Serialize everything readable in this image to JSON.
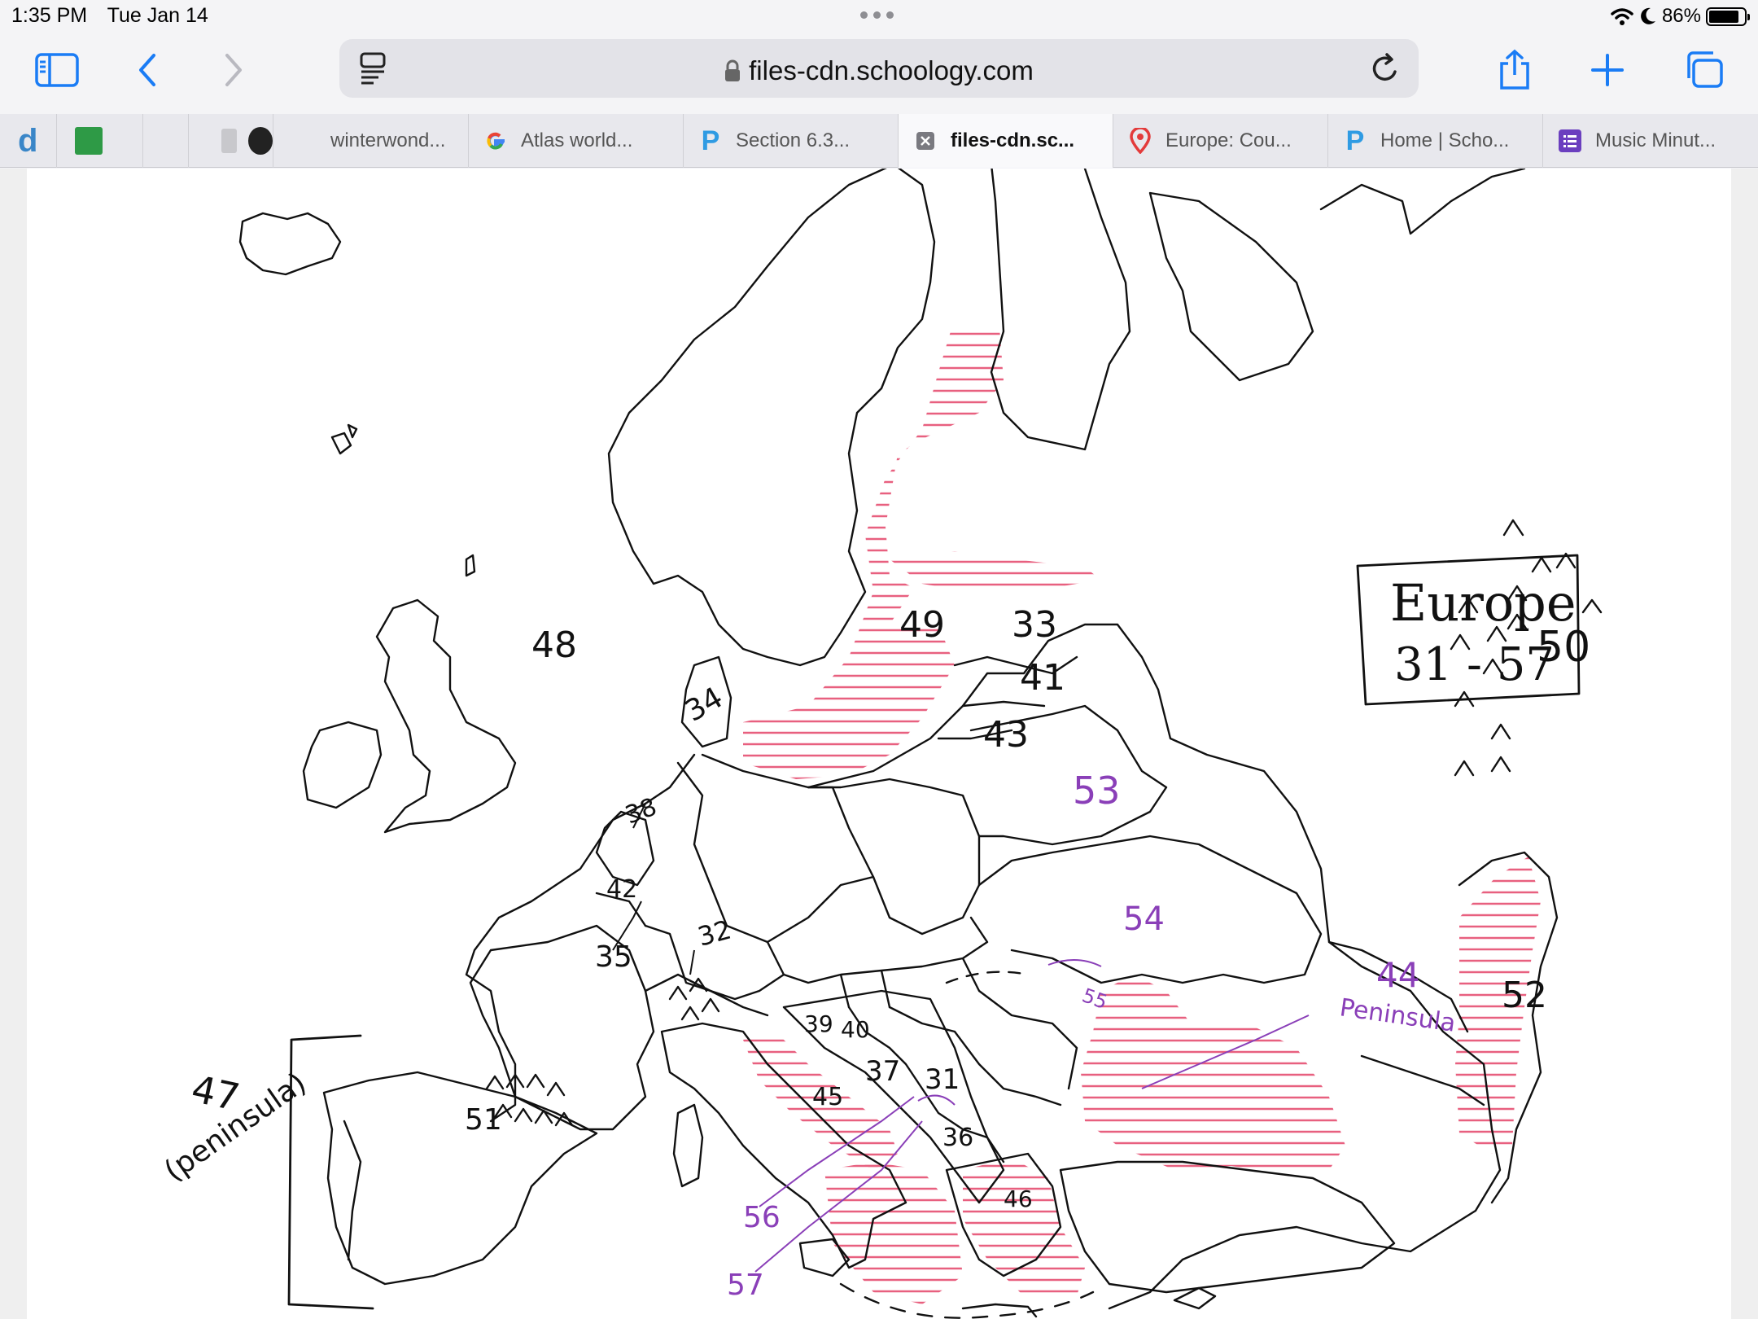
{
  "status": {
    "time": "1:35 PM",
    "date": "Tue Jan 14",
    "battery": "86%",
    "battery_level": 0.86
  },
  "toolbar": {
    "url": "files-cdn.schoology.com",
    "icons": [
      "sidebar-icon",
      "back-icon",
      "forward-icon",
      "reader-icon",
      "lock-icon",
      "reload-icon",
      "share-icon",
      "new-tab-icon",
      "tabs-overview-icon"
    ]
  },
  "tabs": [
    {
      "label": "",
      "icon": "d-icon"
    },
    {
      "label": "",
      "icon": "big-ideas-math-icon"
    },
    {
      "label": "",
      "icon": "blank-tab"
    },
    {
      "label": "",
      "icon": "s-icon"
    },
    {
      "label": "",
      "icon": "commonlit-icon"
    },
    {
      "label": "winterwond...",
      "icon": "none"
    },
    {
      "label": "Atlas world...",
      "icon": "google-icon"
    },
    {
      "label": "Section 6.3...",
      "icon": "schoology-p-icon"
    },
    {
      "label": "files-cdn.sc...",
      "icon": "close-icon",
      "active": true
    },
    {
      "label": "Europe: Cou...",
      "icon": "map-pin-icon"
    },
    {
      "label": "Home | Scho...",
      "icon": "schoology-p-icon"
    },
    {
      "label": "Music Minut...",
      "icon": "forms-icon"
    }
  ],
  "map": {
    "title_line1": "Europe",
    "title_line2": "31 - 57",
    "labels": {
      "n48": "48",
      "n49": "49",
      "n33": "33",
      "n41": "41",
      "n43": "43",
      "n34": "34",
      "n38": "38",
      "n42": "42",
      "n35": "35",
      "n32": "32",
      "n53": "53",
      "n54": "54",
      "n55": "55",
      "n44": "44",
      "n44_sub": "Peninsula",
      "n52": "52",
      "n50": "50",
      "n39": "39",
      "n40": "40",
      "n37": "37",
      "n31": "31",
      "n45": "45",
      "n36": "36",
      "n46": "46",
      "n56": "56",
      "n57": "57",
      "n47": "47",
      "n47_sub": "(peninsula)",
      "n51": "51"
    },
    "colors": {
      "ink": "#111111",
      "hatch": "#e8607f",
      "purple": "#8a3fb8"
    }
  }
}
